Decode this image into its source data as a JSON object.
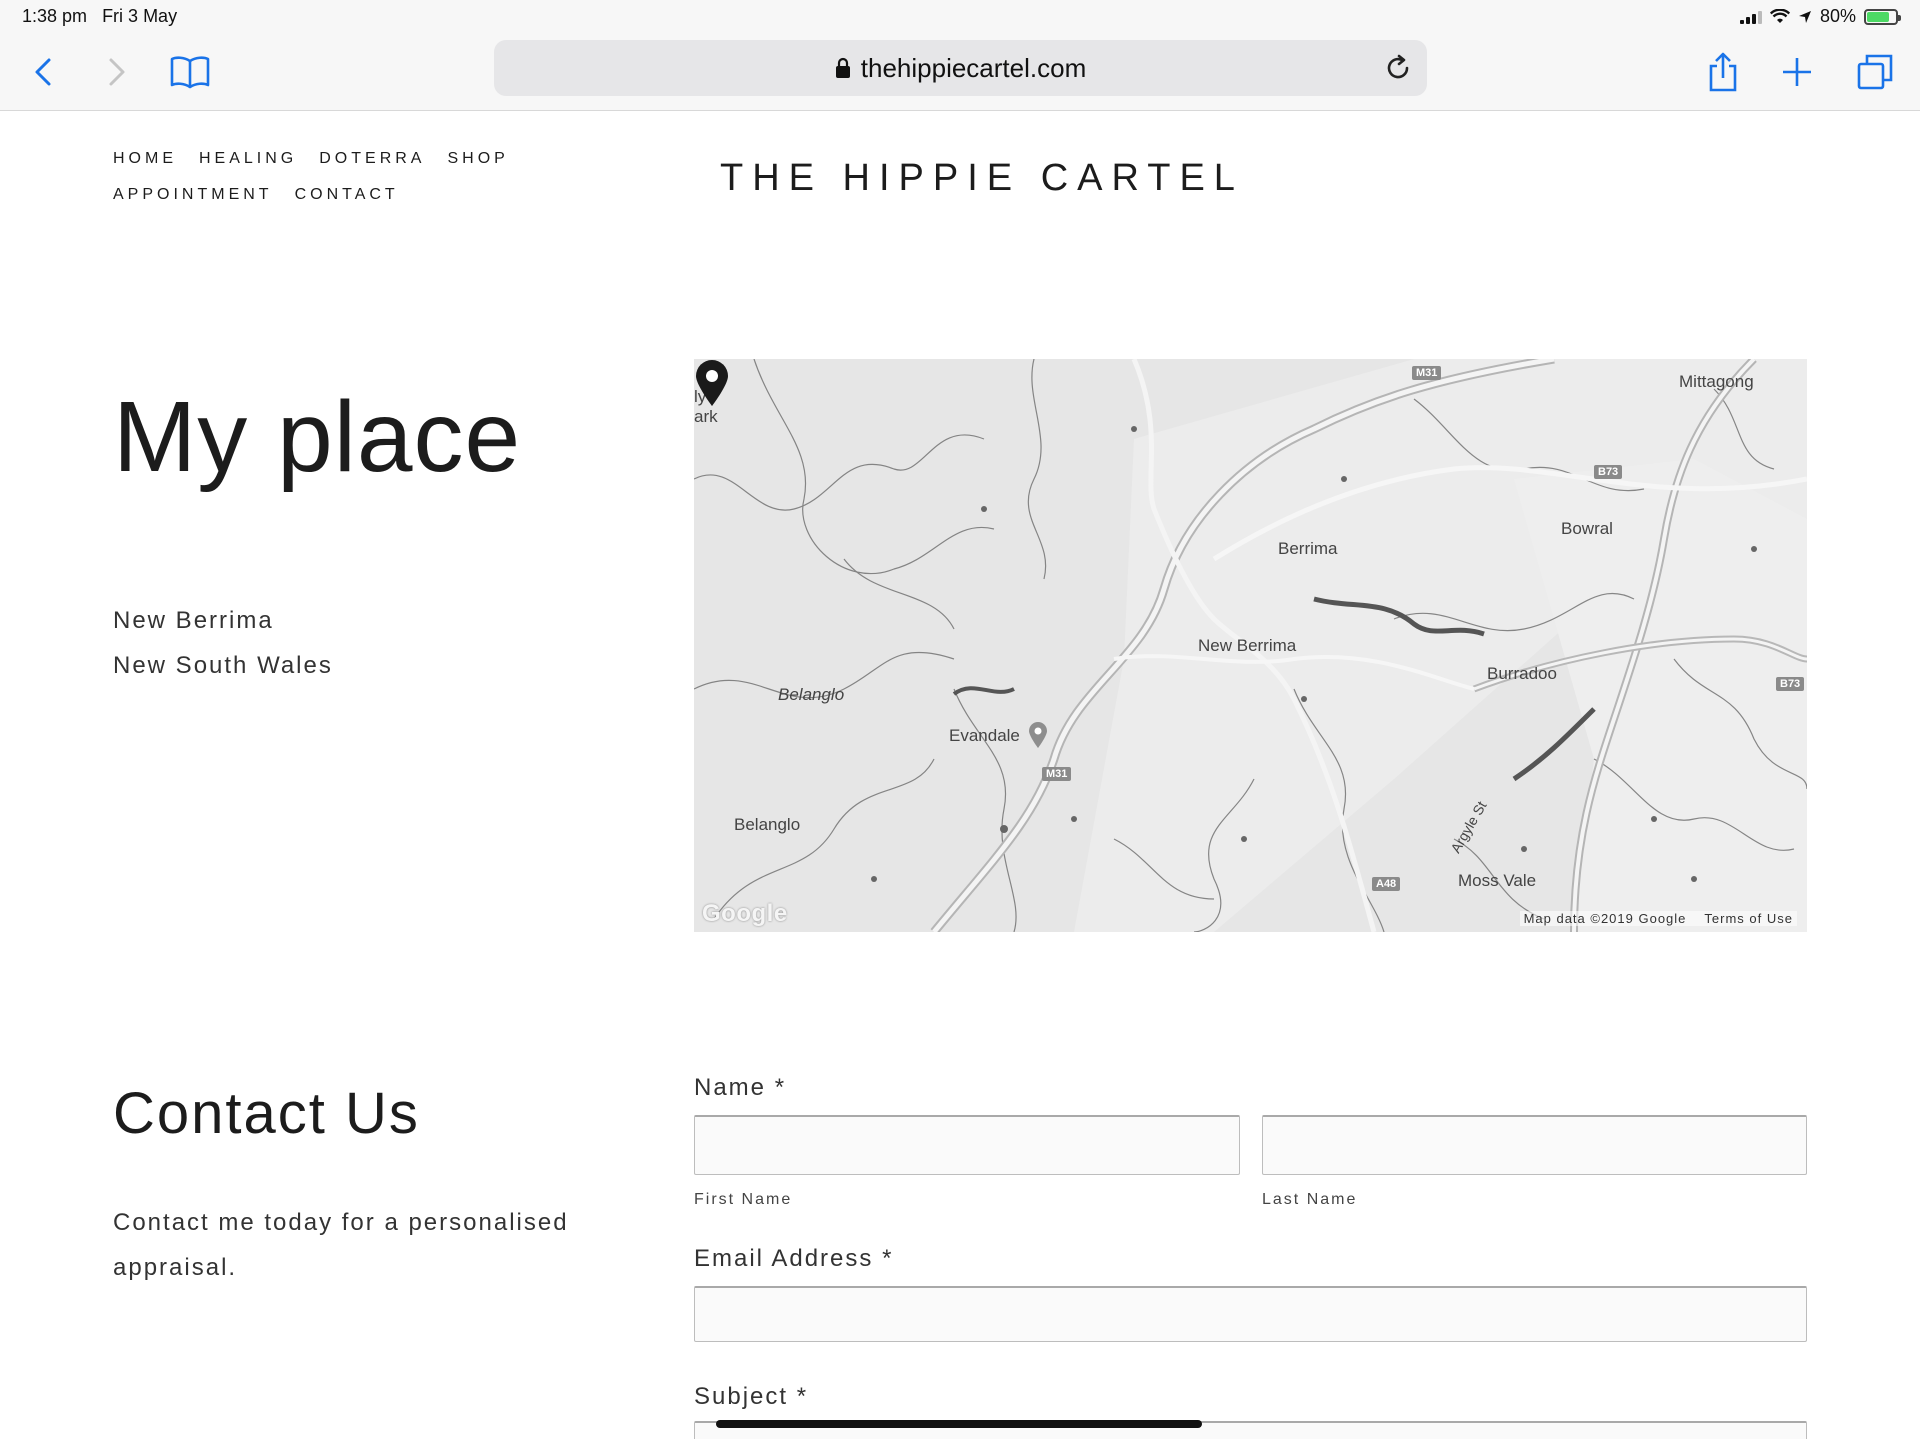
{
  "status_bar": {
    "time": "1:38 pm",
    "date": "Fri 3 May",
    "battery_text": "80%",
    "battery_level": 0.8
  },
  "browser": {
    "url": "thehippiecartel.com",
    "icons": [
      "back-icon",
      "forward-icon",
      "bookmarks-icon",
      "lock-icon",
      "reload-icon",
      "share-icon",
      "new-tab-icon",
      "tabs-icon"
    ]
  },
  "header": {
    "site_title": "THE HIPPIE CARTEL",
    "nav_row1": [
      "HOME",
      "HEALING",
      "DOTERRA",
      "SHOP"
    ],
    "nav_row2": [
      "APPOINTMENT",
      "CONTACT"
    ]
  },
  "place": {
    "heading": "My place",
    "address_line1": "New Berrima",
    "address_line2": "New South Wales"
  },
  "map": {
    "labels": {
      "mittagong": "Mittagong",
      "berrima": "Berrima",
      "bowral": "Bowral",
      "new_berrima": "New Berrima",
      "burradoo": "Burradoo",
      "belanglo_italic": "Belanglo",
      "evandale": "Evandale",
      "belanglo": "Belanglo",
      "moss_vale": "Moss Vale",
      "argyle_st": "Argyle St",
      "edge_top": "ly",
      "edge_bottom": "ark"
    },
    "shields": {
      "m31_top": "M31",
      "m31_bottom": "M31",
      "b73_top": "B73",
      "b73_right": "B73",
      "a48": "A48"
    },
    "attribution": "Map data ©2019 Google",
    "terms": "Terms of Use",
    "logo": "Google"
  },
  "contact": {
    "heading": "Contact Us",
    "text": "Contact me today for a personalised appraisal.",
    "name_label": "Name *",
    "first_name_label": "First Name",
    "last_name_label": "Last Name",
    "email_label": "Email Address *",
    "subject_label": "Subject *"
  }
}
